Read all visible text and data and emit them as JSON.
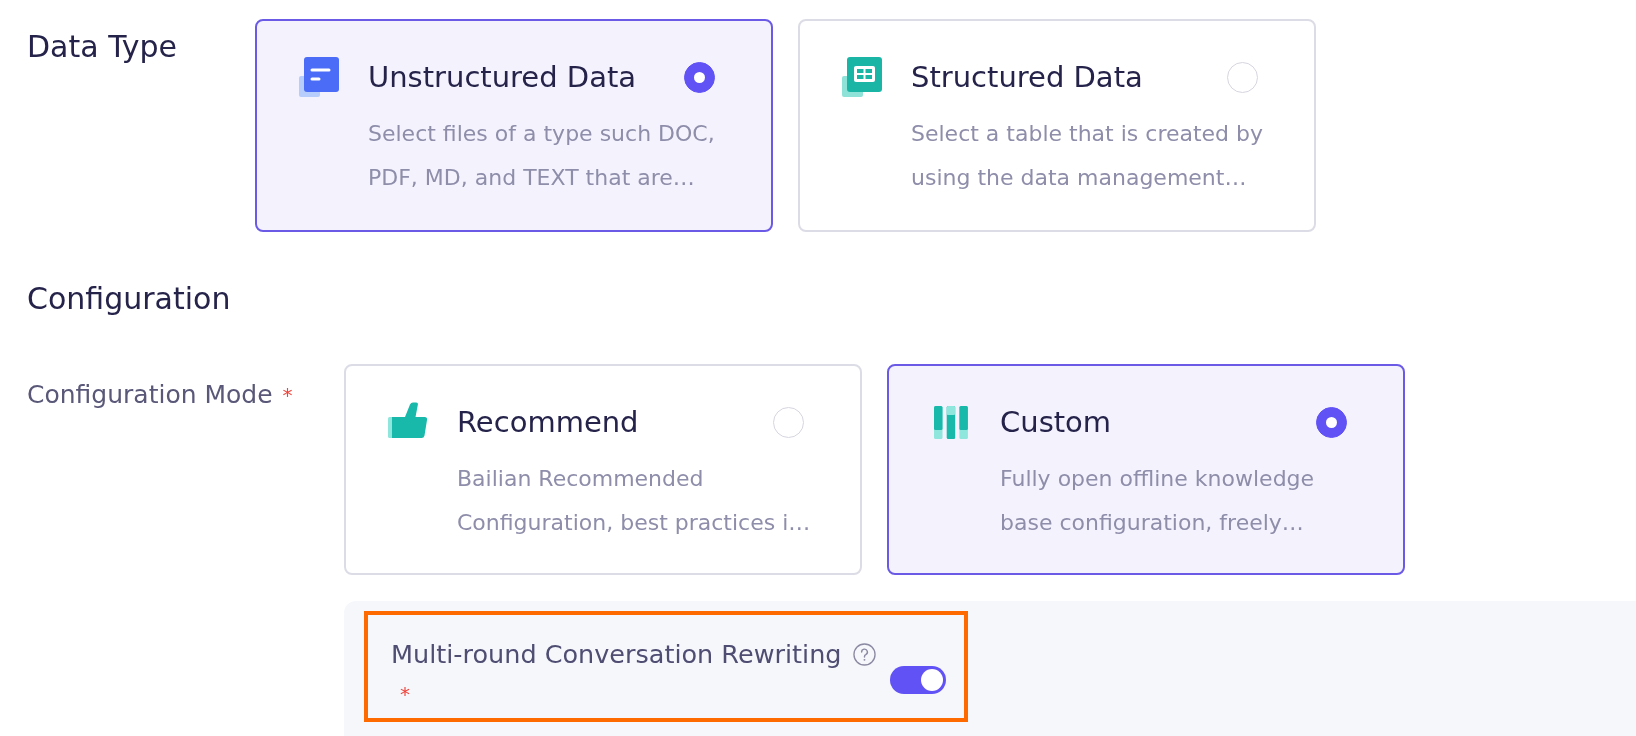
{
  "data_type": {
    "label": "Data Type",
    "options": [
      {
        "kind": "document",
        "title": "Unstructured Data",
        "description": "Select files of a type such DOC, PDF, MD, and TEXT that are…",
        "selected": true
      },
      {
        "kind": "table",
        "title": "Structured Data",
        "description": "Select a table that is created by using the data management…",
        "selected": false
      }
    ]
  },
  "configuration": {
    "title": "Configuration",
    "mode": {
      "label": "Configuration Mode",
      "required_mark": "*",
      "options": [
        {
          "kind": "thumbs-up",
          "title": "Recommend",
          "description": "Bailian Recommended Configuration, best practices i…",
          "selected": false
        },
        {
          "kind": "bars",
          "title": "Custom",
          "description": "Fully open offline knowledge base configuration, freely…",
          "selected": true
        }
      ]
    },
    "multi_round_rewriting": {
      "label": "Multi-round Conversation Rewriting",
      "required_mark": "*",
      "on": true,
      "highlighted": true
    }
  }
}
